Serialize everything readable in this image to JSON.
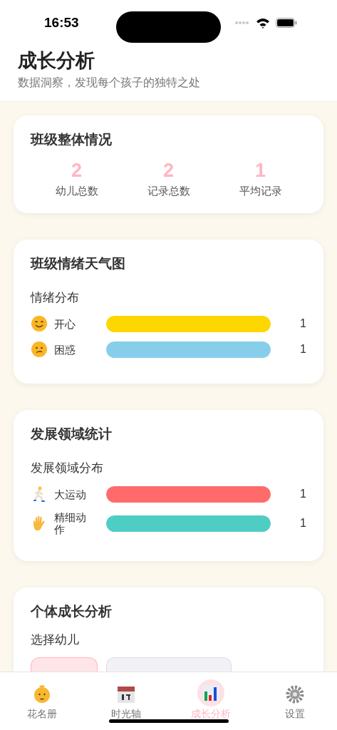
{
  "status_bar": {
    "time": "16:53"
  },
  "header": {
    "title": "成长分析",
    "subtitle": "数据洞察，发现每个孩子的独特之处"
  },
  "overview": {
    "title": "班级整体情况",
    "stats": [
      {
        "value": "2",
        "label": "幼儿总数"
      },
      {
        "value": "2",
        "label": "记录总数"
      },
      {
        "value": "1",
        "label": "平均记录"
      }
    ]
  },
  "emotion": {
    "title": "班级情绪天气图",
    "subtitle": "情绪分布",
    "rows": [
      {
        "label": "开心",
        "level": 1,
        "color": "#ffd700",
        "count": "1"
      },
      {
        "label": "困惑",
        "level": 1,
        "color": "#87ceeb",
        "count": "1"
      }
    ]
  },
  "development": {
    "title": "发展领域统计",
    "subtitle": "发展领域分布",
    "rows": [
      {
        "label": "大运动",
        "level": 1,
        "color": "#ff6b6b",
        "count": "1"
      },
      {
        "label": "精细动作",
        "level": 1,
        "color": "#4ecdc4",
        "count": "1"
      }
    ]
  },
  "individual": {
    "title": "个体成长分析",
    "subtitle": "选择幼儿",
    "chips": [
      {
        "selected": true
      },
      {
        "selected": false
      }
    ]
  },
  "tab_bar": [
    {
      "label": "花名册",
      "selected": false
    },
    {
      "label": "时光轴",
      "selected": false
    },
    {
      "label": "成长分析",
      "selected": true
    },
    {
      "label": "设置",
      "selected": false
    }
  ]
}
